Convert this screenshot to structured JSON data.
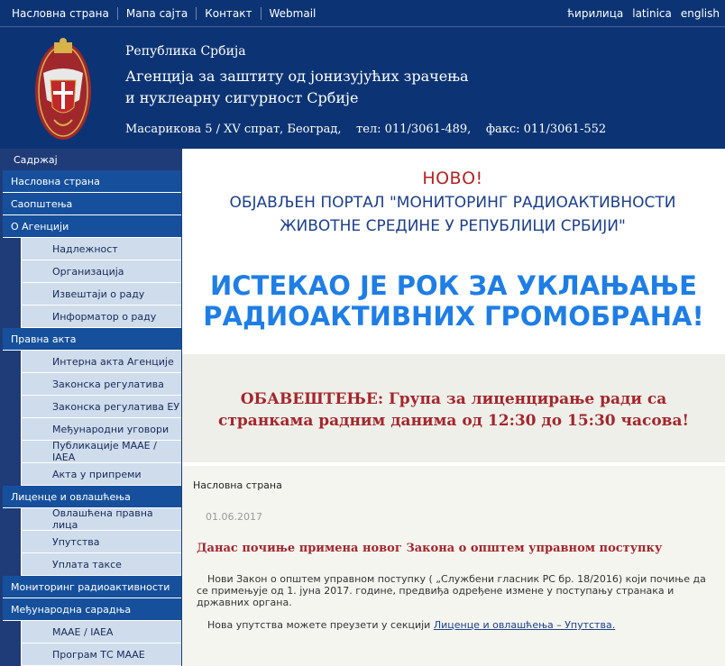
{
  "topnav": {
    "links": [
      "Насловна страна",
      "Мапа сајта",
      "Контакт",
      "Webmail"
    ],
    "languages": [
      "ћирилица",
      "latinica",
      "english"
    ]
  },
  "header": {
    "republic": "Република Србија",
    "agency_line1": "Агенција за заштиту од јонизујућих зрачења",
    "agency_line2": "и нуклеарну сигурност Србије",
    "address": "Масарикова 5 / XV спрат, Београд,    тел: 011/3061-489,    факс: 011/3061-552"
  },
  "sidebar": {
    "title": "Садржај",
    "items": [
      {
        "label": "Насловна страна",
        "level": 0
      },
      {
        "label": "Саопштења",
        "level": 0
      },
      {
        "label": "О Агенцији",
        "level": 0
      },
      {
        "label": "Надлежност",
        "level": 1
      },
      {
        "label": "Организација",
        "level": 1
      },
      {
        "label": "Извештаји о раду",
        "level": 1
      },
      {
        "label": "Информатор о раду",
        "level": 1
      },
      {
        "label": "Правна акта",
        "level": 0
      },
      {
        "label": "Интерна акта Агенције",
        "level": 1
      },
      {
        "label": "Законска регулатива",
        "level": 1
      },
      {
        "label": "Законска регулатива ЕУ",
        "level": 1
      },
      {
        "label": "Међународни уговори",
        "level": 1
      },
      {
        "label": "Публикације МААЕ / IAEA",
        "level": 1
      },
      {
        "label": "Акта у припреми",
        "level": 1
      },
      {
        "label": "Лиценце и овлашћења",
        "level": 0
      },
      {
        "label": "Овлашћена правна лица",
        "level": 1
      },
      {
        "label": "Упутства",
        "level": 1
      },
      {
        "label": "Уплата таксе",
        "level": 1
      },
      {
        "label": "Мониторинг радиоактивности",
        "level": 0
      },
      {
        "label": "Међународна сарадња",
        "level": 0
      },
      {
        "label": "МААЕ / IAEA",
        "level": 1
      },
      {
        "label": "Програм ТС МААЕ",
        "level": 1
      }
    ]
  },
  "banners": {
    "novo": "НОВО!",
    "portal_line1": "ОБЈАВЉЕН ПОРТАЛ \"МОНИТОРИНГ РАДИОАКТИВНОСТИ",
    "portal_line2": "ЖИВОТНЕ СРЕДИНЕ У РЕПУБЛИЦИ СРБИЈИ\"",
    "deadline_line1": "ИСТЕКАО ЈЕ РОК ЗА УКЛАЊАЊЕ",
    "deadline_line2": "РАДИОАКТИВНИХ ГРОМОБРАНА!",
    "notice_line1": "ОБАВЕШТЕЊЕ: Група за лиценцирање ради са",
    "notice_line2": "странкама радним данима од 12:30 до 15:30 часова!"
  },
  "content": {
    "breadcrumb": "Насловна страна",
    "date": "01.06.2017",
    "title": "Данас почиње примена новог Закона о општем управном поступку",
    "body": "Нови Закон о општем управном поступку ( „Службени гласник РС бр. 18/2016) који почиње да се примењује од 1. јуна 2017. године, предвиђа одређене измене у поступању странака и државних органа.",
    "more_prefix": "Нова упутства можете преузети у секцији ",
    "more_link": "Лиценце и овлашћења – Упутства."
  },
  "colors": {
    "nav_bg": "#0c3474",
    "menu_top": "#16509c",
    "menu_sub": "#cfdcec",
    "accent_red": "#a4262c",
    "accent_blue": "#1e7ee6"
  },
  "icons": [
    "coat-of-arms-icon"
  ]
}
